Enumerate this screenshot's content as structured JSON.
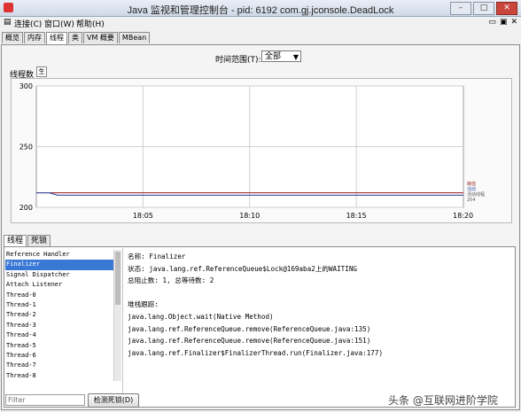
{
  "window": {
    "title": "Java 监视和管理控制台 - pid: 6192 com.gj.jconsole.DeadLock"
  },
  "menu": [
    "连接(C)",
    "窗口(W)",
    "帮助(H)"
  ],
  "tabs": [
    "概览",
    "内存",
    "线程",
    "类",
    "VM 概要",
    "MBean"
  ],
  "time_range": {
    "label": "时间范围(T):",
    "value": "全部"
  },
  "threads_panel": {
    "label": "线程数",
    "toggle": "生"
  },
  "chart_data": {
    "type": "line",
    "ylim": [
      200,
      300
    ],
    "yticks": [
      200,
      250,
      300
    ],
    "xticks": [
      "18:05",
      "18:10",
      "18:15",
      "18:20"
    ],
    "x": [
      0,
      3,
      4,
      5,
      10,
      20,
      30,
      40,
      50,
      60,
      70,
      80,
      90,
      100
    ],
    "series": [
      {
        "name": "峰值",
        "color": "#a33333",
        "values": [
          212,
          212,
          212,
          212,
          212,
          212,
          212,
          212,
          212,
          212,
          212,
          212,
          212,
          212
        ]
      },
      {
        "name": "活动",
        "color": "#3a4fa0",
        "values": [
          212,
          212,
          211,
          210,
          210,
          210,
          210,
          210,
          210,
          210,
          210,
          210,
          210,
          210
        ]
      }
    ],
    "legend": [
      "峰值",
      "活动",
      "活动线程",
      "204"
    ]
  },
  "bottom_tabs": [
    "线程",
    "死锁"
  ],
  "thread_list": [
    "Reference Handler",
    "Finalizer",
    "Signal Dispatcher",
    "Attach Listener",
    "Thread-0",
    "Thread-1",
    "Thread-2",
    "Thread-3",
    "Thread-4",
    "Thread-5",
    "Thread-6",
    "Thread-7",
    "Thread-8"
  ],
  "selected_thread_index": 1,
  "detail": [
    "名称: Finalizer",
    "状态: java.lang.ref.ReferenceQueue$Lock@169aba2上的WAITING",
    "总阻止数: 1, 总等待数: 2",
    "",
    "堆栈跟踪:",
    "java.lang.Object.wait(Native Method)",
    "java.lang.ref.ReferenceQueue.remove(ReferenceQueue.java:135)",
    "java.lang.ref.ReferenceQueue.remove(ReferenceQueue.java:151)",
    "java.lang.ref.Finalizer$FinalizerThread.run(Finalizer.java:177)"
  ],
  "filter": {
    "placeholder": "Filter"
  },
  "detect_deadlock_label": "检测死锁(D)",
  "watermark": "头条 @互联网进阶学院"
}
